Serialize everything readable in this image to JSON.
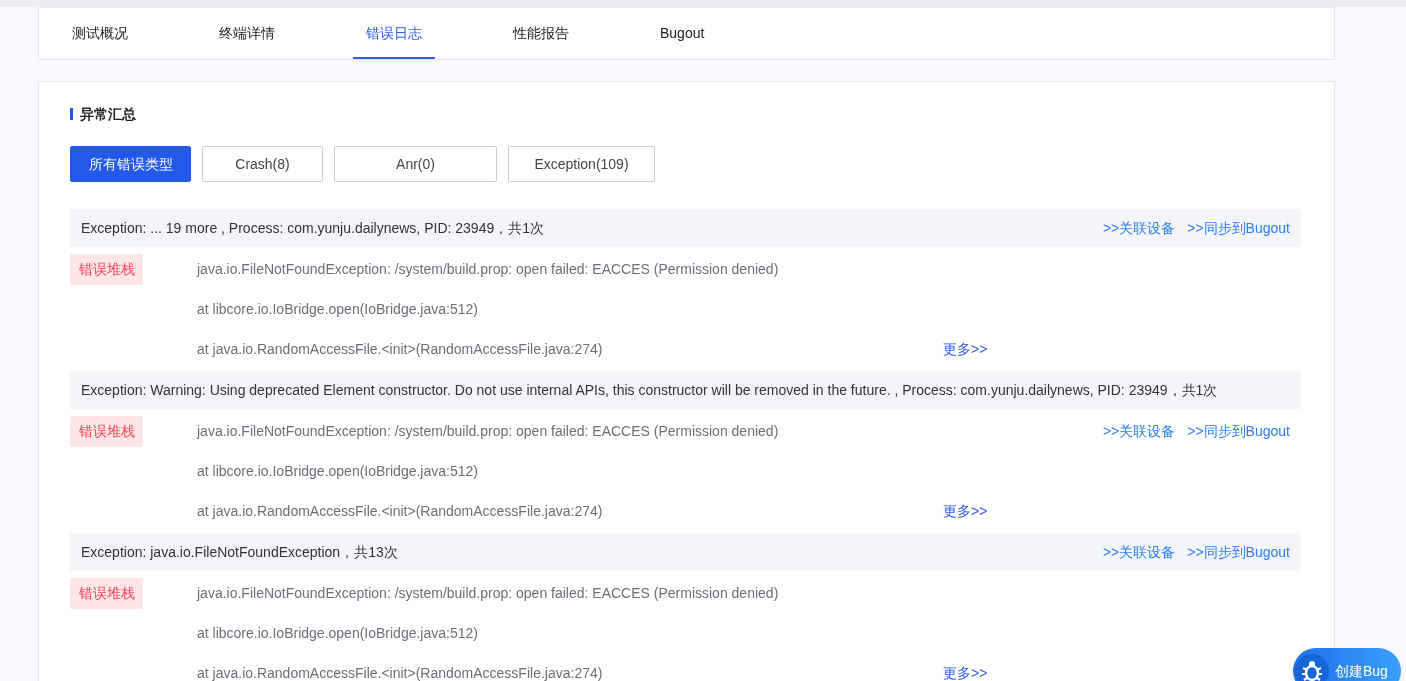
{
  "tabs": [
    {
      "label": "测试概况",
      "selected": false
    },
    {
      "label": "终端详情",
      "selected": false
    },
    {
      "label": "错误日志",
      "selected": true
    },
    {
      "label": "性能报告",
      "selected": false
    },
    {
      "label": "Bugout",
      "selected": false
    }
  ],
  "section": {
    "title": "异常汇总"
  },
  "filters": [
    {
      "label": "所有错误类型",
      "selected": true
    },
    {
      "label": "Crash(8)",
      "selected": false
    },
    {
      "label": "Anr(0)",
      "selected": false
    },
    {
      "label": "Exception(109)",
      "selected": false
    }
  ],
  "entries": [
    {
      "summary": "Exception: ... 19 more , Process: com.yunju.dailynews, PID: 23949，共1次",
      "actions_in_header": true,
      "actions": [
        ">>关联设备",
        ">>同步到Bugout"
      ],
      "badge": "错误堆栈",
      "stack": [
        "java.io.FileNotFoundException: /system/build.prop: open failed: EACCES (Permission denied)",
        "at libcore.io.IoBridge.open(IoBridge.java:512)",
        "at java.io.RandomAccessFile.<init>(RandomAccessFile.java:274)"
      ],
      "more": "更多>>"
    },
    {
      "summary": "Exception: Warning: Using deprecated Element constructor. Do not use internal APIs, this constructor will be removed in the future. , Process: com.yunju.dailynews, PID: 23949，共1次",
      "actions_in_header": false,
      "actions": [
        ">>关联设备",
        ">>同步到Bugout"
      ],
      "badge": "错误堆栈",
      "stack": [
        "java.io.FileNotFoundException: /system/build.prop: open failed: EACCES (Permission denied)",
        "at libcore.io.IoBridge.open(IoBridge.java:512)",
        "at java.io.RandomAccessFile.<init>(RandomAccessFile.java:274)"
      ],
      "more": "更多>>"
    },
    {
      "summary": "Exception: java.io.FileNotFoundException，共13次",
      "actions_in_header": true,
      "actions": [
        ">>关联设备",
        ">>同步到Bugout"
      ],
      "badge": "错误堆栈",
      "stack": [
        "java.io.FileNotFoundException: /system/build.prop: open failed: EACCES (Permission denied)",
        "at libcore.io.IoBridge.open(IoBridge.java:512)",
        "at java.io.RandomAccessFile.<init>(RandomAccessFile.java:274)"
      ],
      "more": "更多>>"
    }
  ],
  "floating_button": {
    "label": "创建Bug"
  }
}
